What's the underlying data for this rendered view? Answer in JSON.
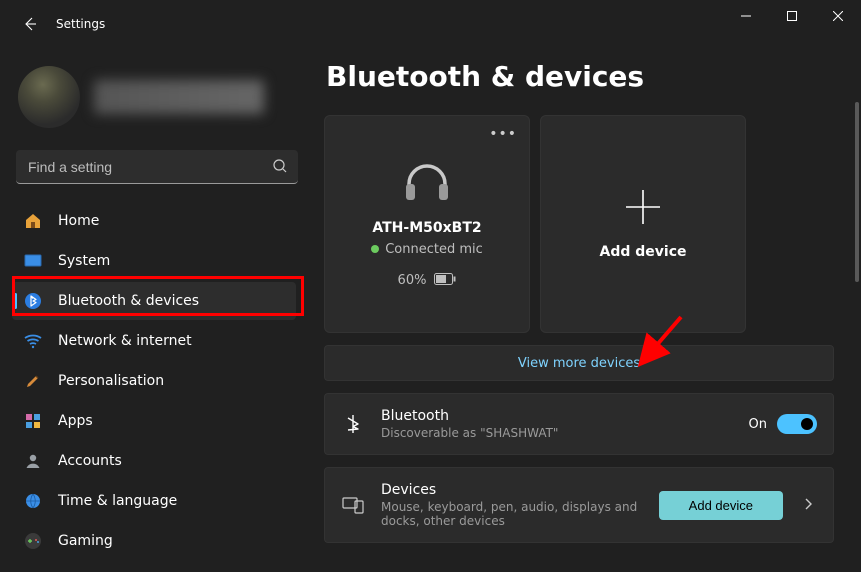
{
  "window": {
    "title": "Settings"
  },
  "search": {
    "placeholder": "Find a setting"
  },
  "nav": {
    "items": [
      {
        "key": "home",
        "label": "Home"
      },
      {
        "key": "system",
        "label": "System"
      },
      {
        "key": "bluetooth",
        "label": "Bluetooth & devices",
        "active": true
      },
      {
        "key": "network",
        "label": "Network & internet"
      },
      {
        "key": "personalisation",
        "label": "Personalisation"
      },
      {
        "key": "apps",
        "label": "Apps"
      },
      {
        "key": "accounts",
        "label": "Accounts"
      },
      {
        "key": "timelang",
        "label": "Time & language"
      },
      {
        "key": "gaming",
        "label": "Gaming"
      }
    ]
  },
  "page": {
    "heading": "Bluetooth & devices",
    "device_tile": {
      "name": "ATH-M50xBT2",
      "status": "Connected mic",
      "battery_percent": "60%"
    },
    "add_tile": {
      "label": "Add device"
    },
    "view_more": "View more devices",
    "bluetooth_row": {
      "title": "Bluetooth",
      "subtitle": "Discoverable as \"SHASHWAT\"",
      "toggle_label": "On"
    },
    "devices_row": {
      "title": "Devices",
      "subtitle": "Mouse, keyboard, pen, audio, displays and docks, other devices",
      "button": "Add device"
    }
  },
  "colors": {
    "accent": "#4cc2ff",
    "pill": "#76d0d6",
    "link": "#7fd3ff",
    "highlight": "#ff0000",
    "annot": "#ff0000"
  }
}
